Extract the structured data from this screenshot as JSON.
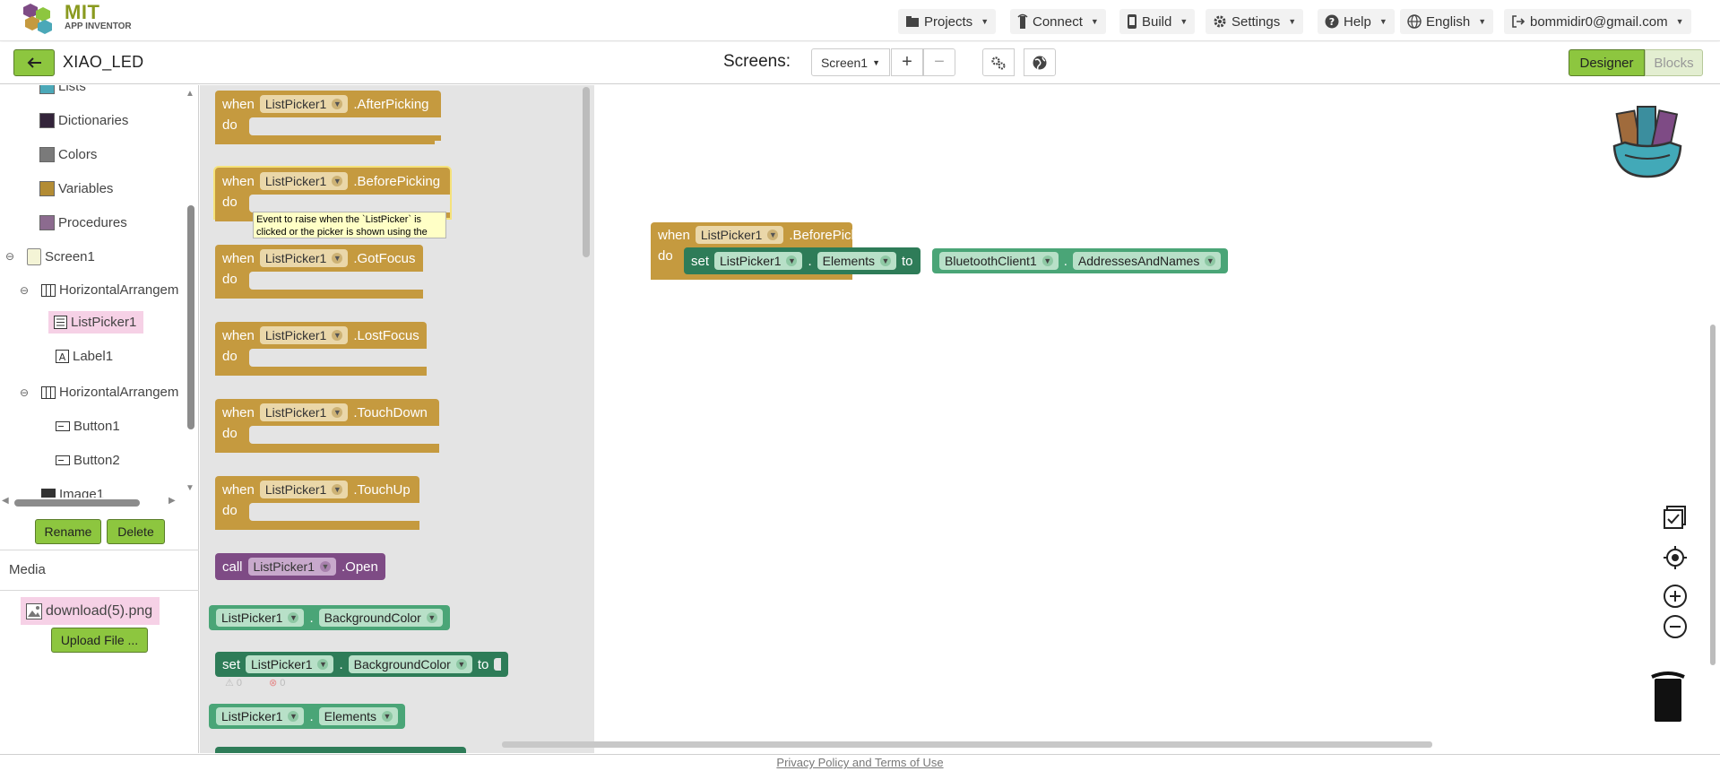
{
  "app": {
    "logo_title": "MIT",
    "logo_subtitle": "APP INVENTOR"
  },
  "topnav": {
    "projects": "Projects",
    "connect": "Connect",
    "build": "Build",
    "settings": "Settings",
    "help": "Help",
    "language": "English",
    "account": "bommidir0@gmail.com"
  },
  "projectbar": {
    "project_name": "XIAO_LED",
    "screens_label": "Screens:",
    "screen_selected": "Screen1",
    "designer": "Designer",
    "blocks": "Blocks"
  },
  "tree": {
    "items": [
      {
        "label": "Lists",
        "color": "#4ba8b8"
      },
      {
        "label": "Dictionaries",
        "color": "#33243a"
      },
      {
        "label": "Colors",
        "color": "#7a7a7a"
      },
      {
        "label": "Variables",
        "color": "#b38c34"
      },
      {
        "label": "Procedures",
        "color": "#8c6b8f"
      },
      {
        "label": "Screen1"
      },
      {
        "label": "HorizontalArrangem"
      },
      {
        "label": "ListPicker1"
      },
      {
        "label": "Label1"
      },
      {
        "label": "HorizontalArrangem"
      },
      {
        "label": "Button1"
      },
      {
        "label": "Button2"
      },
      {
        "label": "Image1"
      }
    ],
    "rename": "Rename",
    "delete": "Delete"
  },
  "media": {
    "label": "Media",
    "file": "download(5).png",
    "upload": "Upload File ..."
  },
  "flyout": {
    "when": "when",
    "do": "do",
    "call": "call",
    "set": "set",
    "to": "to",
    "component": "ListPicker1",
    "events": [
      ".AfterPicking",
      ".BeforePicking",
      ".GotFocus",
      ".LostFocus",
      ".TouchDown",
      ".TouchUp"
    ],
    "open_method": ".Open",
    "prop_background": "BackgroundColor",
    "prop_elements": "Elements",
    "dot": ".",
    "tooltip": "Event to raise when the `ListPicker` is clicked or the picker is shown using the",
    "warn_count": "0",
    "error_count": "0"
  },
  "workspace": {
    "when": "when",
    "do": "do",
    "set": "set",
    "to": "to",
    "dot": ".",
    "component": "ListPicker1",
    "event": ".BeforePicking",
    "property": "Elements",
    "bt_component": "BluetoothClient1",
    "bt_property": "AddressesAndNames"
  },
  "footer": {
    "privacy": "Privacy Policy and Terms of Use"
  },
  "colors": {
    "accent_green": "#8dc63f",
    "event_block": "#c59a3f",
    "call_block": "#7e4b85",
    "getter_block": "#4aa577",
    "setter_block": "#2e7c58"
  }
}
